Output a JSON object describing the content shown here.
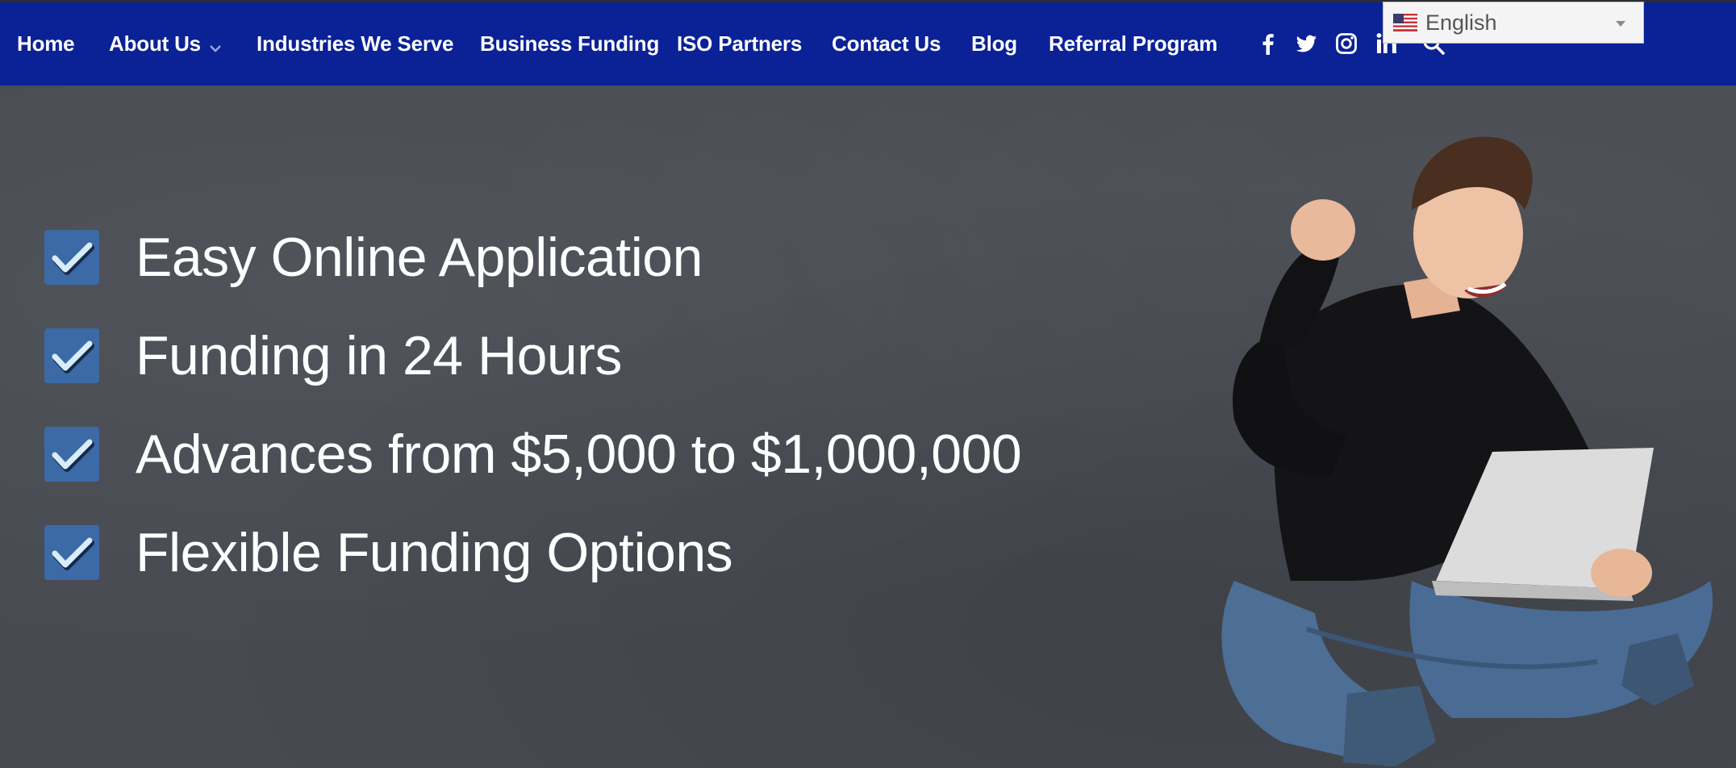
{
  "nav": {
    "items": [
      {
        "label": "Home",
        "has_dropdown": false
      },
      {
        "label": "About Us",
        "has_dropdown": true
      },
      {
        "label": "Industries We Serve",
        "has_dropdown": false
      },
      {
        "label": "Business Funding",
        "has_dropdown": false
      },
      {
        "label": "ISO Partners",
        "has_dropdown": false
      },
      {
        "label": "Contact Us",
        "has_dropdown": false
      },
      {
        "label": "Blog",
        "has_dropdown": false
      },
      {
        "label": "Referral Program",
        "has_dropdown": false
      }
    ],
    "social_icons": [
      "facebook-icon",
      "twitter-icon",
      "instagram-icon",
      "linkedin-icon",
      "search-icon"
    ],
    "background_color": "#0b2196"
  },
  "language_selector": {
    "selected": "English",
    "flag_icon": "us-flag-icon"
  },
  "hero": {
    "features": [
      "Easy Online Application",
      "Funding in 24 Hours",
      "Advances from $5,000 to $1,000,000",
      "Flexible Funding Options"
    ],
    "check_icon": "checkbox-checked-icon",
    "image": "person-with-laptop-celebrating"
  }
}
